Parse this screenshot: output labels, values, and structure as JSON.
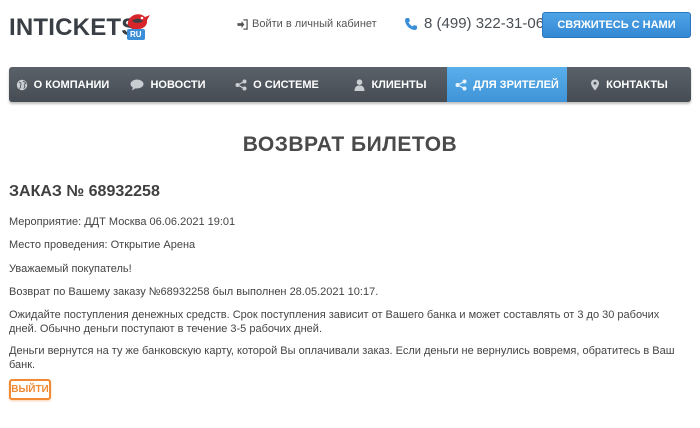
{
  "header": {
    "logo_text": "INTICKETS",
    "logo_tld": "RU",
    "login_label": "Войти в личный кабинет",
    "phone": "8 (499) 322-31-06",
    "contact_button": "СВЯЖИТЕСЬ С НАМИ"
  },
  "nav": {
    "items": [
      {
        "label": "О КОМПАНИИ",
        "icon": "globe-icon"
      },
      {
        "label": "НОВОСТИ",
        "icon": "chat-icon"
      },
      {
        "label": "О СИСТЕМЕ",
        "icon": "share-icon"
      },
      {
        "label": "КЛИЕНТЫ",
        "icon": "user-icon"
      },
      {
        "label": "ДЛЯ ЗРИТЕЛЕЙ",
        "icon": "share-icon"
      },
      {
        "label": "КОНТАКТЫ",
        "icon": "map-pin-icon"
      }
    ],
    "active_index": 4
  },
  "main": {
    "page_title": "ВОЗВРАТ БИЛЕТОВ",
    "order_title": "ЗАКАЗ № 68932258",
    "event": "Мероприятие: ДДТ Москва 06.06.2021 19:01",
    "venue": "Место проведения: Открытие Арена",
    "greeting": "Уважаемый покупатель!",
    "refund_done": "Возврат по Вашему заказу №68932258 был выполнен 28.05.2021 10:17.",
    "wait_info": "Ожидайте поступления денежных средств. Срок поступления зависит от Вашего банка и может составлять от 3 до 30 рабочих дней. Обычно деньги поступают в течение 3-5 рабочих дней.",
    "card_info": "Деньги вернутся на ту же банковскую карту, которой Вы оплачивали заказ. Если деньги не вернулись вовремя, обратитесь в Ваш банк.",
    "logout_button": "ВЫЙТИ"
  },
  "colors": {
    "accent_blue": "#3f94d8",
    "nav_dark": "#4f565d",
    "logout_orange": "#f08a34"
  }
}
